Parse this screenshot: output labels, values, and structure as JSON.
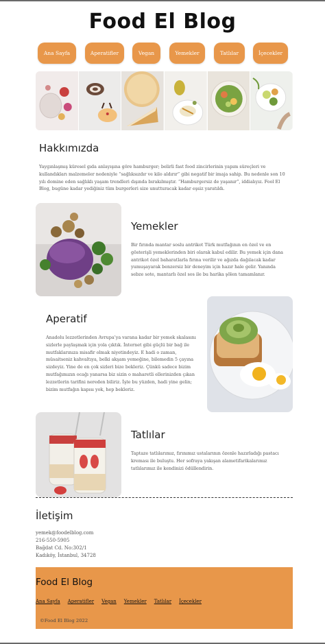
{
  "site": {
    "title": "Food El Blog"
  },
  "nav": {
    "items": [
      "Ana Sayfa",
      "Aperatifler",
      "Vegan",
      "Yemekler",
      "Tatlılar",
      "İçecekler"
    ]
  },
  "about": {
    "title": "Hakkımızda",
    "text": "Yaygınlaşmış küresel gıda anlayışına göre hamburger; belirli fast food zincirlerinin yapım süreçleri ve kullandıkları malzemeler nedeniyle “sağlıksızdır ve kilo aldırır” gibi negatif bir imaja sahip. Bu nedenle son 10 yılı domine eden sağlıklı yaşam trendleri dışında bırakılmıştır. “Hamburgersiz de yaşanır”, iddialıyız. Fool El Blog, bugüne kadar yediğiniz tüm burgerleri size unutturacak kadar eşsiz yaratıldı."
  },
  "sections": [
    {
      "title": "Yemekler",
      "text": "Bir fırında mantar soslu antrikot Türk mutfağının en özel ve en gösterişli yemeklerinden biri olarak kabul edilir. Bu yemek için dana antrikot özel baharatlarla fırına verilir ve ağızda dağılacak kadar yumuşayarak benzersiz bir deneyim için hazır hale gelir. Yanında sebze sote, mantarlı özel sos ile bu harika şölen tamamlanır."
    },
    {
      "title": "Aperatif",
      "text": "Anadolu lezzetlerinden Avrupa’ya varana kadar bir yemek skalasını sizlerle paylaşmak için yola çıktık. İnternet gibi güçlü bir bağ ile mutfaklarınıza misafir olmak niyetindeyiz. E hadi o zaman, müsaitseniz kahvaltıya, belki akşam yemeğine, bilemedin 5 çayına sizdeyiz. Yine de en çok sizleri bize bekleriz. Çünkü sadece bizim mutfağımızın ocağı yanarsa biz sizin o maharetli ellerinizden çıkan lezzetlerin tarifini nereden biliriz. İşte bu yüzden, hadi yine gelin; bizim mutfağın kapısı yok, hep bekleriz."
    },
    {
      "title": "Tatlılar",
      "text": "Taptaze tatlılarımız, fırınımız ustalarının özenle hazırladığı pastacı kreması ile buluştu. Her sofraya yakışan alametifarikalarımız tatlılarımız ile kendinizi ödüllendirin."
    }
  ],
  "contact": {
    "title": "İletişim",
    "email": "yemek@foodelblog.com",
    "phone": "216-550-5905",
    "address1": "Bağdat Cd. No:302/1",
    "address2": "Kadıköy, İstanbul, 34728"
  },
  "footer": {
    "brand": "Food El Blog",
    "links": [
      "Ana Sayfa",
      "Aperatifler",
      "Vegan",
      "Yemekler",
      "Tatlılar",
      "İçecekler"
    ],
    "copyright": "©Food El Blog 2022"
  },
  "colors": {
    "accent": "#e8974a",
    "text": "#555555",
    "heading": "#222222"
  }
}
